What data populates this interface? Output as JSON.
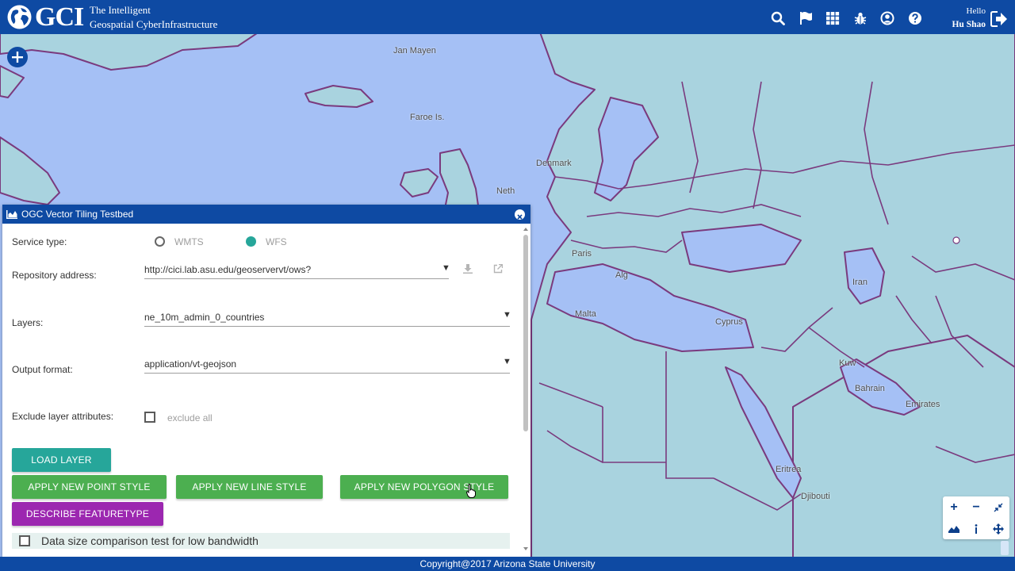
{
  "header": {
    "brand": "GCI",
    "tagline_line1": "The Intelligent",
    "tagline_line2": "Geospatial CyberInfrastructure",
    "icons": [
      "search-icon",
      "flag-icon",
      "apps-grid-icon",
      "bug-icon",
      "account-icon",
      "help-icon",
      "logout-icon"
    ],
    "greeting": "Hello",
    "user_name": "Hu Shao"
  },
  "map": {
    "labels": [
      "Jan Mayen",
      "Faroe Is.",
      "Denmark",
      "Neth",
      "Paris",
      "Alg",
      "Malta",
      "Cyprus",
      "Iran",
      "Kuw",
      "Bahrain",
      "Emirates",
      "Eritrea",
      "Djibouti"
    ],
    "colors": {
      "water": "#a5c0f5",
      "land": "#a9d3df",
      "border": "#7a3a7e"
    },
    "tools": [
      "zoom-in-icon",
      "zoom-out-icon",
      "collapse-icon",
      "basemap-icon",
      "info-icon",
      "pan-icon"
    ]
  },
  "panel": {
    "title": "OGC Vector Tiling Testbed",
    "service_type_label": "Service type:",
    "service_options": [
      "WMTS",
      "WFS"
    ],
    "service_selected": "WFS",
    "repository_label": "Repository address:",
    "repository_value": "http://cici.lab.asu.edu/geoservervt/ows?",
    "layers_label": "Layers:",
    "layers_value": "ne_10m_admin_0_countries",
    "output_label": "Output format:",
    "output_value": "application/vt-geojson",
    "exclude_label": "Exclude layer attributes:",
    "exclude_checkbox_label": "exclude all",
    "buttons": {
      "load_layer": "LOAD LAYER",
      "point_style": "APPLY NEW POINT STYLE",
      "line_style": "APPLY NEW LINE STYLE",
      "polygon_style": "APPLY NEW POLYGON STYLE",
      "describe": "DESCRIBE FEATURETYPE"
    },
    "test_label": "Data size comparison test for low bandwidth"
  },
  "footer": {
    "copyright": "Copyright@2017 Arizona State University"
  }
}
